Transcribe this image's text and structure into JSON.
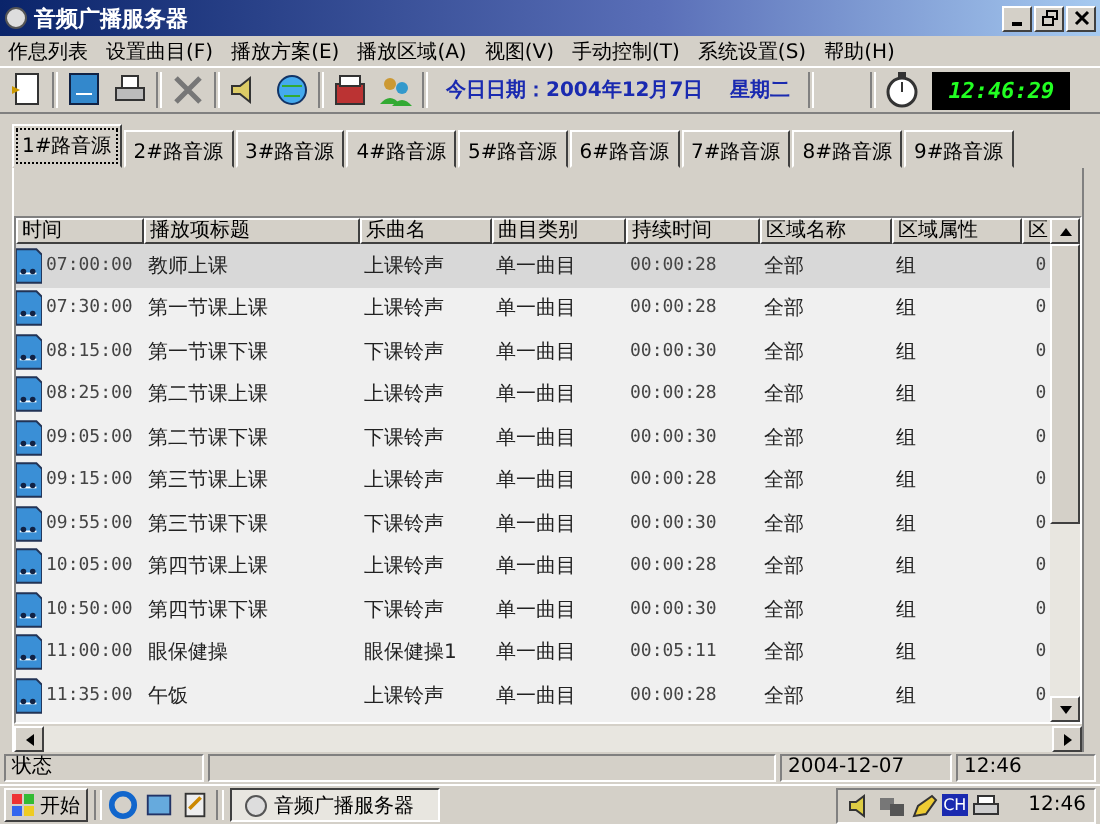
{
  "window": {
    "title": "音频广播服务器"
  },
  "menu": [
    "作息列表",
    "设置曲目(F)",
    "播放方案(E)",
    "播放区域(A)",
    "视图(V)",
    "手动控制(T)",
    "系统设置(S)",
    "帮助(H)"
  ],
  "toolbar": {
    "date_text": "今日日期：2004年12月7日　 星期二",
    "clock": "12:46:29"
  },
  "tabs": [
    {
      "label": "1#路音源",
      "selected": true
    },
    {
      "label": "2#路音源",
      "selected": false
    },
    {
      "label": "3#路音源",
      "selected": false
    },
    {
      "label": "4#路音源",
      "selected": false
    },
    {
      "label": "5#路音源",
      "selected": false
    },
    {
      "label": "6#路音源",
      "selected": false
    },
    {
      "label": "7#路音源",
      "selected": false
    },
    {
      "label": "8#路音源",
      "selected": false
    },
    {
      "label": "9#路音源",
      "selected": false
    }
  ],
  "table": {
    "columns": [
      "时间",
      "播放项标题",
      "乐曲名",
      "曲目类别",
      "持续时间",
      "区域名称",
      "区域属性",
      "区"
    ],
    "rows": [
      {
        "selected": true,
        "cells": [
          "07:00:00",
          "教师上课",
          "上课铃声",
          "单一曲目",
          "00:00:28",
          "全部",
          "组",
          "0"
        ]
      },
      {
        "selected": false,
        "cells": [
          "07:30:00",
          "第一节课上课",
          "上课铃声",
          "单一曲目",
          "00:00:28",
          "全部",
          "组",
          "0"
        ]
      },
      {
        "selected": false,
        "cells": [
          "08:15:00",
          "第一节课下课",
          "下课铃声",
          "单一曲目",
          "00:00:30",
          "全部",
          "组",
          "0"
        ]
      },
      {
        "selected": false,
        "cells": [
          "08:25:00",
          "第二节课上课",
          "上课铃声",
          "单一曲目",
          "00:00:28",
          "全部",
          "组",
          "0"
        ]
      },
      {
        "selected": false,
        "cells": [
          "09:05:00",
          "第二节课下课",
          "下课铃声",
          "单一曲目",
          "00:00:30",
          "全部",
          "组",
          "0"
        ]
      },
      {
        "selected": false,
        "cells": [
          "09:15:00",
          "第三节课上课",
          "上课铃声",
          "单一曲目",
          "00:00:28",
          "全部",
          "组",
          "0"
        ]
      },
      {
        "selected": false,
        "cells": [
          "09:55:00",
          "第三节课下课",
          "下课铃声",
          "单一曲目",
          "00:00:30",
          "全部",
          "组",
          "0"
        ]
      },
      {
        "selected": false,
        "cells": [
          "10:05:00",
          "第四节课上课",
          "上课铃声",
          "单一曲目",
          "00:00:28",
          "全部",
          "组",
          "0"
        ]
      },
      {
        "selected": false,
        "cells": [
          "10:50:00",
          "第四节课下课",
          "下课铃声",
          "单一曲目",
          "00:00:30",
          "全部",
          "组",
          "0"
        ]
      },
      {
        "selected": false,
        "cells": [
          "11:00:00",
          "眼保健操",
          "眼保健操1",
          "单一曲目",
          "00:05:11",
          "全部",
          "组",
          "0"
        ]
      },
      {
        "selected": false,
        "cells": [
          "11:35:00",
          "午饭",
          "上课铃声",
          "单一曲目",
          "00:00:28",
          "全部",
          "组",
          "0"
        ]
      }
    ]
  },
  "status_bar": [
    "状态",
    "2004-12-07",
    "12:46"
  ],
  "taskbar": {
    "start": "开始",
    "task": "音频广播服务器",
    "tray_badge": "CH",
    "time": "12:46"
  }
}
